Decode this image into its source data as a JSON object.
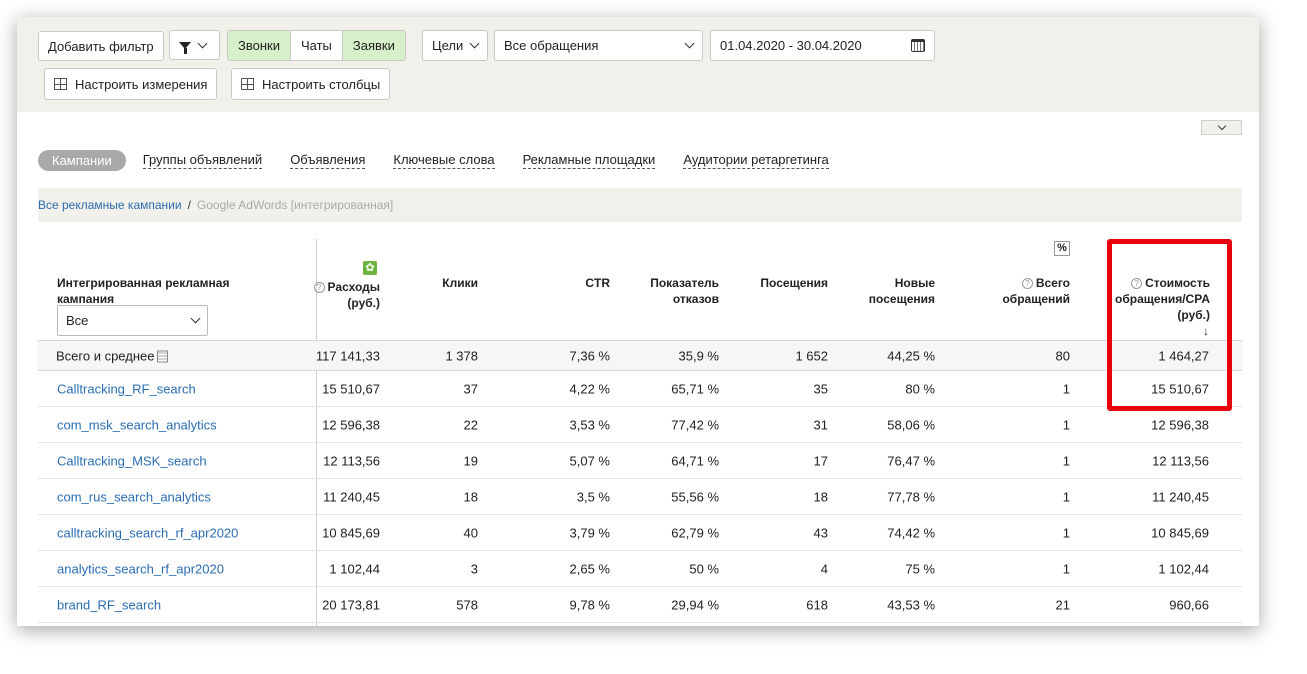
{
  "toolbar": {
    "add_filter": "Добавить фильтр",
    "segments": [
      {
        "label": "Звонки",
        "active": true
      },
      {
        "label": "Чаты",
        "active": false
      },
      {
        "label": "Заявки",
        "active": true
      }
    ],
    "goals": "Цели",
    "requests_select": "Все обращения",
    "date_range": "01.04.2020 - 30.04.2020",
    "configure_dimensions": "Настроить измерения",
    "configure_columns": "Настроить столбцы"
  },
  "tabs": {
    "active": "Кампании",
    "items": [
      "Группы объявлений",
      "Объявления",
      "Ключевые слова",
      "Рекламные площадки",
      "Аудитории ретаргетинга"
    ]
  },
  "breadcrumb": {
    "root": "Все рекламные кампании",
    "separator": "/",
    "current": "Google AdWords [интегрированная]"
  },
  "table": {
    "headers": {
      "campaign": "Интегрированная рекламная кампания",
      "spend": "Расходы (руб.)",
      "clicks": "Клики",
      "ctr": "CTR",
      "bounce": "Показатель отказов",
      "visits": "Посещения",
      "new_visits": "Новые посещения",
      "total_requests": "Всего обращений",
      "cpa": "Стоимость обращения/CPA (руб.)",
      "pct_toggle": "%",
      "gear": "✿",
      "question": "?",
      "sort": "↓"
    },
    "filter_select": "Все",
    "total": {
      "name": "Всего и среднее",
      "spend": "117 141,33",
      "clicks": "1 378",
      "ctr": "7,36 %",
      "bounce": "35,9 %",
      "visits": "1 652",
      "new_visits": "44,25 %",
      "requests": "80",
      "cpa": "1 464,27"
    },
    "rows": [
      {
        "name": "Calltracking_RF_search",
        "spend": "15 510,67",
        "clicks": "37",
        "ctr": "4,22 %",
        "bounce": "65,71 %",
        "visits": "35",
        "new_visits": "80 %",
        "requests": "1",
        "cpa": "15 510,67"
      },
      {
        "name": "com_msk_search_analytics",
        "spend": "12 596,38",
        "clicks": "22",
        "ctr": "3,53 %",
        "bounce": "77,42 %",
        "visits": "31",
        "new_visits": "58,06 %",
        "requests": "1",
        "cpa": "12 596,38"
      },
      {
        "name": "Calltracking_MSK_search",
        "spend": "12 113,56",
        "clicks": "19",
        "ctr": "5,07 %",
        "bounce": "64,71 %",
        "visits": "17",
        "new_visits": "76,47 %",
        "requests": "1",
        "cpa": "12 113,56"
      },
      {
        "name": "com_rus_search_analytics",
        "spend": "11 240,45",
        "clicks": "18",
        "ctr": "3,5 %",
        "bounce": "55,56 %",
        "visits": "18",
        "new_visits": "77,78 %",
        "requests": "1",
        "cpa": "11 240,45"
      },
      {
        "name": "calltracking_search_rf_apr2020",
        "spend": "10 845,69",
        "clicks": "40",
        "ctr": "3,79 %",
        "bounce": "62,79 %",
        "visits": "43",
        "new_visits": "74,42 %",
        "requests": "1",
        "cpa": "10 845,69"
      },
      {
        "name": "analytics_search_rf_apr2020",
        "spend": "1 102,44",
        "clicks": "3",
        "ctr": "2,65 %",
        "bounce": "50 %",
        "visits": "4",
        "new_visits": "75 %",
        "requests": "1",
        "cpa": "1 102,44"
      },
      {
        "name": "brand_RF_search",
        "spend": "20 173,81",
        "clicks": "578",
        "ctr": "9,78 %",
        "bounce": "29,94 %",
        "visits": "618",
        "new_visits": "43,53 %",
        "requests": "21",
        "cpa": "960,66"
      }
    ]
  },
  "colors": {
    "highlight": "#e8000d",
    "link": "#2a6db3",
    "active_segment": "#d7f0c9",
    "toolbar_bg": "#f2f0ea"
  }
}
